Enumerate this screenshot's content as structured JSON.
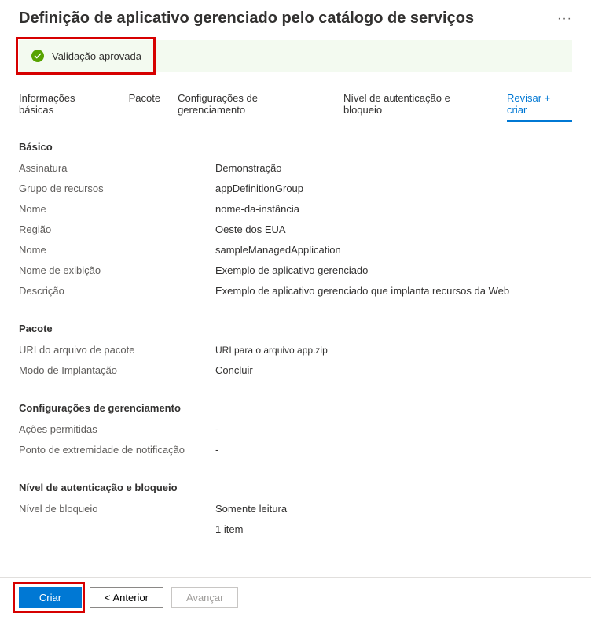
{
  "header": {
    "title": "Definição de aplicativo gerenciado pelo catálogo de serviços"
  },
  "validation": {
    "message": "Validação aprovada"
  },
  "tabs": {
    "basic": "Informações básicas",
    "package": "Pacote",
    "management": "Configurações de gerenciamento",
    "auth": "Nível de autenticação e bloqueio",
    "review": "Revisar + criar"
  },
  "sections": {
    "basic": {
      "title": "Básico",
      "rows": {
        "subscription_label": "Assinatura",
        "subscription_value": "Demonstração",
        "rg_label": "Grupo de recursos",
        "rg_value": "appDefinitionGroup",
        "name1_label": "Nome",
        "name1_value": "nome-da-instância",
        "region_label": "Região",
        "region_value": "Oeste dos EUA",
        "name2_label": "Nome",
        "name2_value": "sampleManagedApplication",
        "display_label": "Nome de exibição",
        "display_value": "Exemplo de aplicativo gerenciado",
        "desc_label": "Descrição",
        "desc_value": "Exemplo de aplicativo gerenciado que implanta recursos da Web"
      }
    },
    "package": {
      "title": "Pacote",
      "rows": {
        "uri_label": "URI do arquivo de pacote",
        "uri_value": "URI para o arquivo app.zip",
        "mode_label": "Modo de Implantação",
        "mode_value": "Concluir"
      }
    },
    "management": {
      "title": "Configurações de gerenciamento",
      "rows": {
        "actions_label": "Ações permitidas",
        "actions_value": "-",
        "endpoint_label": "Ponto de extremidade de notificação",
        "endpoint_value": "-"
      }
    },
    "auth": {
      "title": "Nível de autenticação e bloqueio",
      "rows": {
        "lock_label": "Nível de bloqueio",
        "lock_value": "Somente leitura",
        "items_label": "",
        "items_value": "1 item"
      }
    }
  },
  "footer": {
    "create": "Criar",
    "previous": "< Anterior",
    "next": "Avançar"
  }
}
